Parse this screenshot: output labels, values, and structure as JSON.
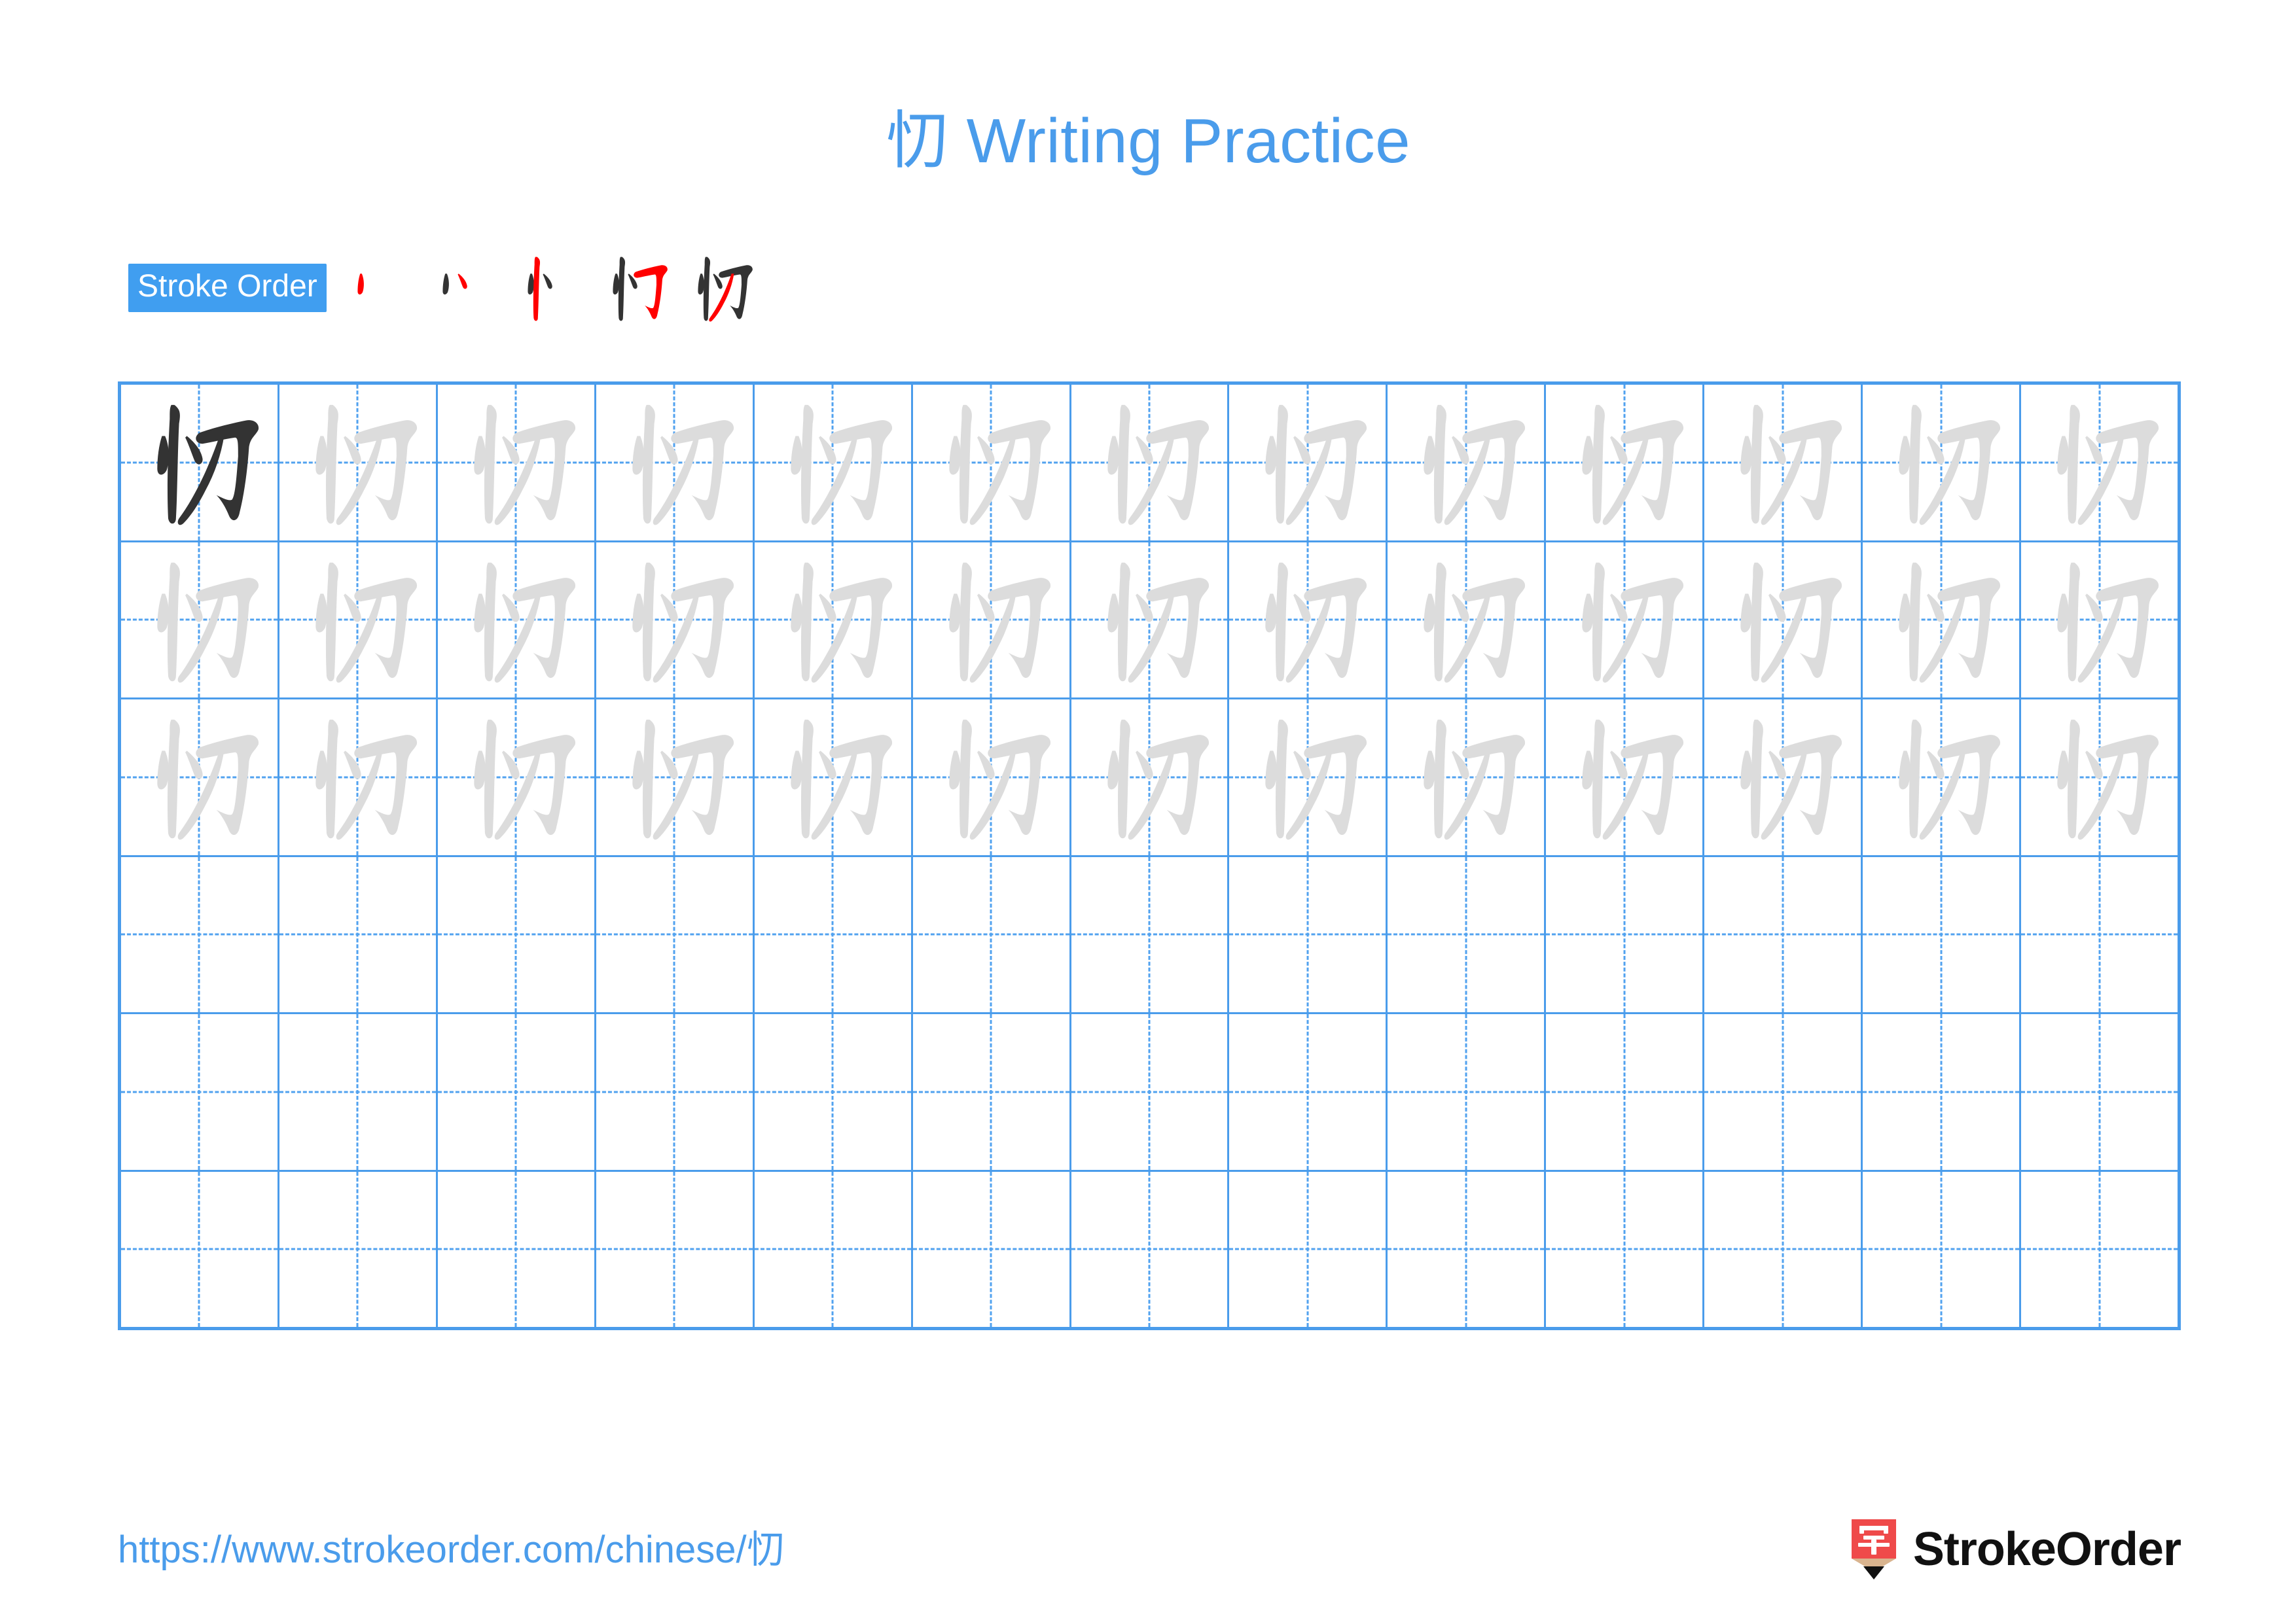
{
  "page": {
    "title": "忉 Writing Practice",
    "character": "忉",
    "background_color": "#ffffff",
    "accent_color": "#4a9ceb",
    "badge_color": "#409ef0",
    "new_stroke_color": "#ff0000",
    "ink_color": "#333333",
    "trace_color": "#dcdcdc"
  },
  "stroke_order": {
    "badge_label": "Stroke Order",
    "stroke_count": 5,
    "steps": [
      {
        "index": 1,
        "strokes_shown": 1,
        "new_stroke_index": 1
      },
      {
        "index": 2,
        "strokes_shown": 2,
        "new_stroke_index": 2
      },
      {
        "index": 3,
        "strokes_shown": 3,
        "new_stroke_index": 3
      },
      {
        "index": 4,
        "strokes_shown": 4,
        "new_stroke_index": 4
      },
      {
        "index": 5,
        "strokes_shown": 5,
        "new_stroke_index": 5
      }
    ]
  },
  "grid": {
    "columns": 13,
    "rows": 6,
    "rows_data": [
      {
        "row": 1,
        "cells": [
          "ink",
          "trace",
          "trace",
          "trace",
          "trace",
          "trace",
          "trace",
          "trace",
          "trace",
          "trace",
          "trace",
          "trace",
          "trace"
        ]
      },
      {
        "row": 2,
        "cells": [
          "trace",
          "trace",
          "trace",
          "trace",
          "trace",
          "trace",
          "trace",
          "trace",
          "trace",
          "trace",
          "trace",
          "trace",
          "trace"
        ]
      },
      {
        "row": 3,
        "cells": [
          "trace",
          "trace",
          "trace",
          "trace",
          "trace",
          "trace",
          "trace",
          "trace",
          "trace",
          "trace",
          "trace",
          "trace",
          "trace"
        ]
      },
      {
        "row": 4,
        "cells": [
          "empty",
          "empty",
          "empty",
          "empty",
          "empty",
          "empty",
          "empty",
          "empty",
          "empty",
          "empty",
          "empty",
          "empty",
          "empty"
        ]
      },
      {
        "row": 5,
        "cells": [
          "empty",
          "empty",
          "empty",
          "empty",
          "empty",
          "empty",
          "empty",
          "empty",
          "empty",
          "empty",
          "empty",
          "empty",
          "empty"
        ]
      },
      {
        "row": 6,
        "cells": [
          "empty",
          "empty",
          "empty",
          "empty",
          "empty",
          "empty",
          "empty",
          "empty",
          "empty",
          "empty",
          "empty",
          "empty",
          "empty"
        ]
      }
    ]
  },
  "footer": {
    "url": "https://www.strokeorder.com/chinese/忉",
    "logo_text": "StrokeOrder",
    "logo_glyph": "字",
    "logo_body_color": "#ef4a4a",
    "logo_tip_color": "#d9b48f",
    "logo_point_color": "#111111"
  }
}
